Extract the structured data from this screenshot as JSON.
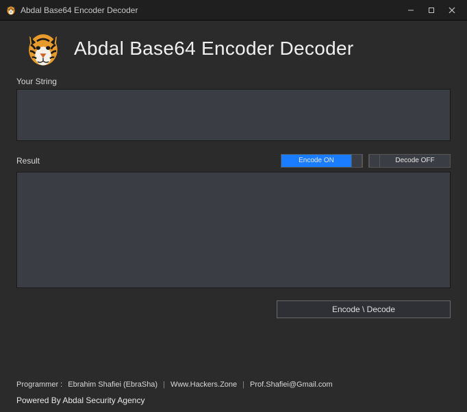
{
  "window": {
    "title": "Abdal Base64 Encoder Decoder"
  },
  "header": {
    "app_title": "Abdal Base64 Encoder Decoder"
  },
  "labels": {
    "your_string": "Your String",
    "result": "Result"
  },
  "inputs": {
    "your_string_value": "",
    "result_value": ""
  },
  "toggles": {
    "encode": {
      "label": "Encode ON",
      "state": "on"
    },
    "decode": {
      "label": "Decode OFF",
      "state": "off"
    }
  },
  "actions": {
    "encode_decode": "Encode \\ Decode"
  },
  "footer": {
    "programmer_label": "Programmer :",
    "programmer_name": "Ebrahim Shafiei (EbraSha)",
    "website": "Www.Hackers.Zone",
    "email": "Prof.Shafiei@Gmail.com",
    "powered_by": "Powered By Abdal Security Agency"
  },
  "icons": {
    "tiger": "tiger-icon"
  }
}
